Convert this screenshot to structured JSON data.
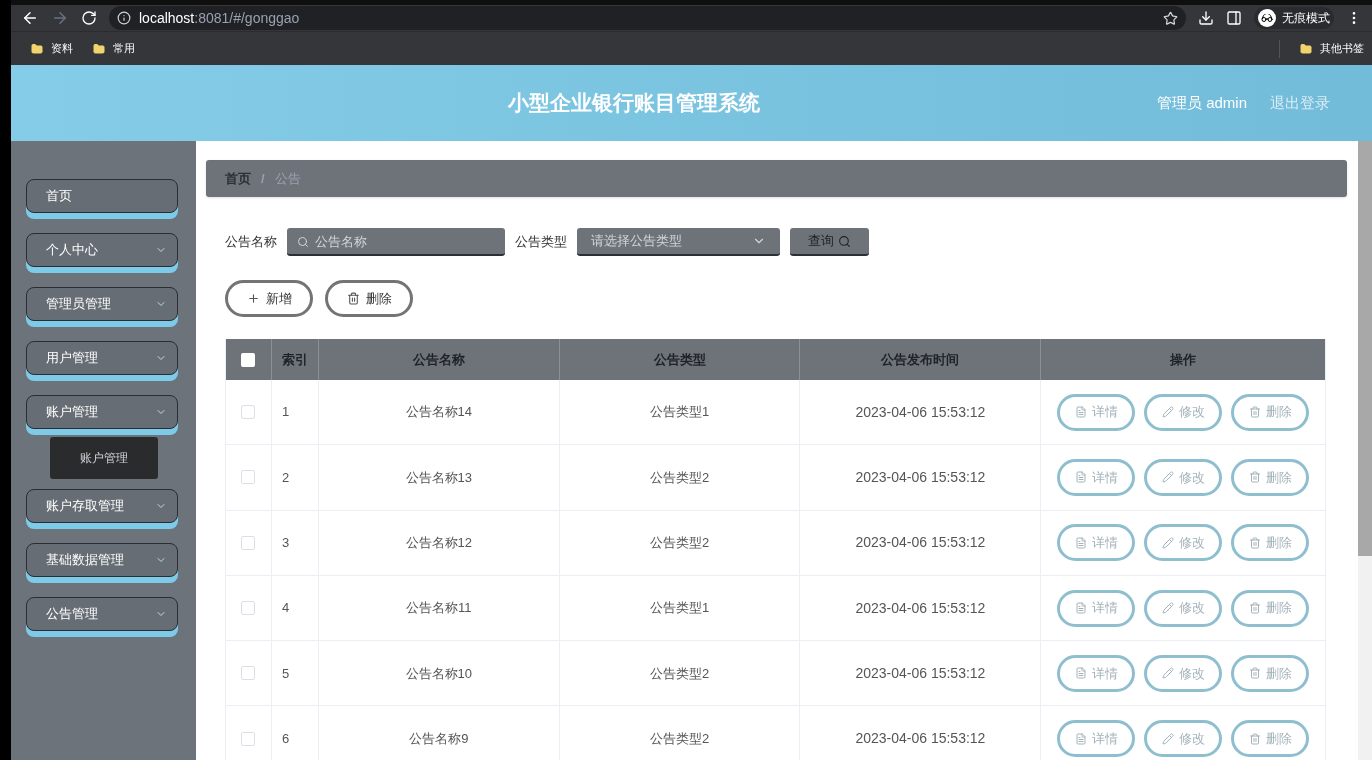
{
  "browser": {
    "url_host": "localhost",
    "url_rest": ":8081/#/gonggao",
    "incognito_label": "无痕模式",
    "bookmarks": [
      "资料",
      "常用"
    ],
    "other_bookmarks": "其他书签"
  },
  "header": {
    "title": "小型企业银行账目管理系统",
    "user": "管理员 admin",
    "logout": "退出登录"
  },
  "sidebar": {
    "items": [
      {
        "label": "首页",
        "has_submenu": false
      },
      {
        "label": "个人中心",
        "has_submenu": true
      },
      {
        "label": "管理员管理",
        "has_submenu": true
      },
      {
        "label": "用户管理",
        "has_submenu": true
      },
      {
        "label": "账户管理",
        "has_submenu": true,
        "flyout": "账户管理"
      },
      {
        "label": "账户存取管理",
        "has_submenu": true
      },
      {
        "label": "基础数据管理",
        "has_submenu": true
      },
      {
        "label": "公告管理",
        "has_submenu": true
      }
    ]
  },
  "breadcrumb": {
    "separator": "/",
    "items": [
      {
        "label": "首页",
        "current": false
      },
      {
        "label": "公告",
        "current": true
      }
    ]
  },
  "search": {
    "fields": [
      {
        "label": "公告名称",
        "kind": "text",
        "placeholder": "公告名称"
      },
      {
        "label": "公告类型",
        "kind": "select",
        "placeholder": "请选择公告类型"
      }
    ],
    "button": "查询"
  },
  "actions": [
    {
      "kind": "add",
      "label": "新增"
    },
    {
      "kind": "delete",
      "label": "删除"
    }
  ],
  "table": {
    "select_all": false,
    "columns": [
      "索引",
      "公告名称",
      "公告类型",
      "公告发布时间",
      "操作"
    ],
    "rows": [
      {
        "checked": false,
        "index": "1",
        "name": "公告名称14",
        "type": "公告类型1",
        "time": "2023-04-06 15:53:12",
        "actions": [
          {
            "kind": "detail",
            "label": "详情"
          },
          {
            "kind": "edit",
            "label": "修改"
          },
          {
            "kind": "delete",
            "label": "删除"
          }
        ]
      },
      {
        "checked": false,
        "index": "2",
        "name": "公告名称13",
        "type": "公告类型2",
        "time": "2023-04-06 15:53:12",
        "actions": [
          {
            "kind": "detail",
            "label": "详情"
          },
          {
            "kind": "edit",
            "label": "修改"
          },
          {
            "kind": "delete",
            "label": "删除"
          }
        ]
      },
      {
        "checked": false,
        "index": "3",
        "name": "公告名称12",
        "type": "公告类型2",
        "time": "2023-04-06 15:53:12",
        "actions": [
          {
            "kind": "detail",
            "label": "详情"
          },
          {
            "kind": "edit",
            "label": "修改"
          },
          {
            "kind": "delete",
            "label": "删除"
          }
        ]
      },
      {
        "checked": false,
        "index": "4",
        "name": "公告名称11",
        "type": "公告类型1",
        "time": "2023-04-06 15:53:12",
        "actions": [
          {
            "kind": "detail",
            "label": "详情"
          },
          {
            "kind": "edit",
            "label": "修改"
          },
          {
            "kind": "delete",
            "label": "删除"
          }
        ]
      },
      {
        "checked": false,
        "index": "5",
        "name": "公告名称10",
        "type": "公告类型2",
        "time": "2023-04-06 15:53:12",
        "actions": [
          {
            "kind": "detail",
            "label": "详情"
          },
          {
            "kind": "edit",
            "label": "修改"
          },
          {
            "kind": "delete",
            "label": "删除"
          }
        ]
      },
      {
        "checked": false,
        "index": "6",
        "name": "公告名称9",
        "type": "公告类型2",
        "time": "2023-04-06 15:53:12",
        "actions": [
          {
            "kind": "detail",
            "label": "详情"
          },
          {
            "kind": "edit",
            "label": "修改"
          },
          {
            "kind": "delete",
            "label": "删除"
          }
        ]
      }
    ]
  }
}
